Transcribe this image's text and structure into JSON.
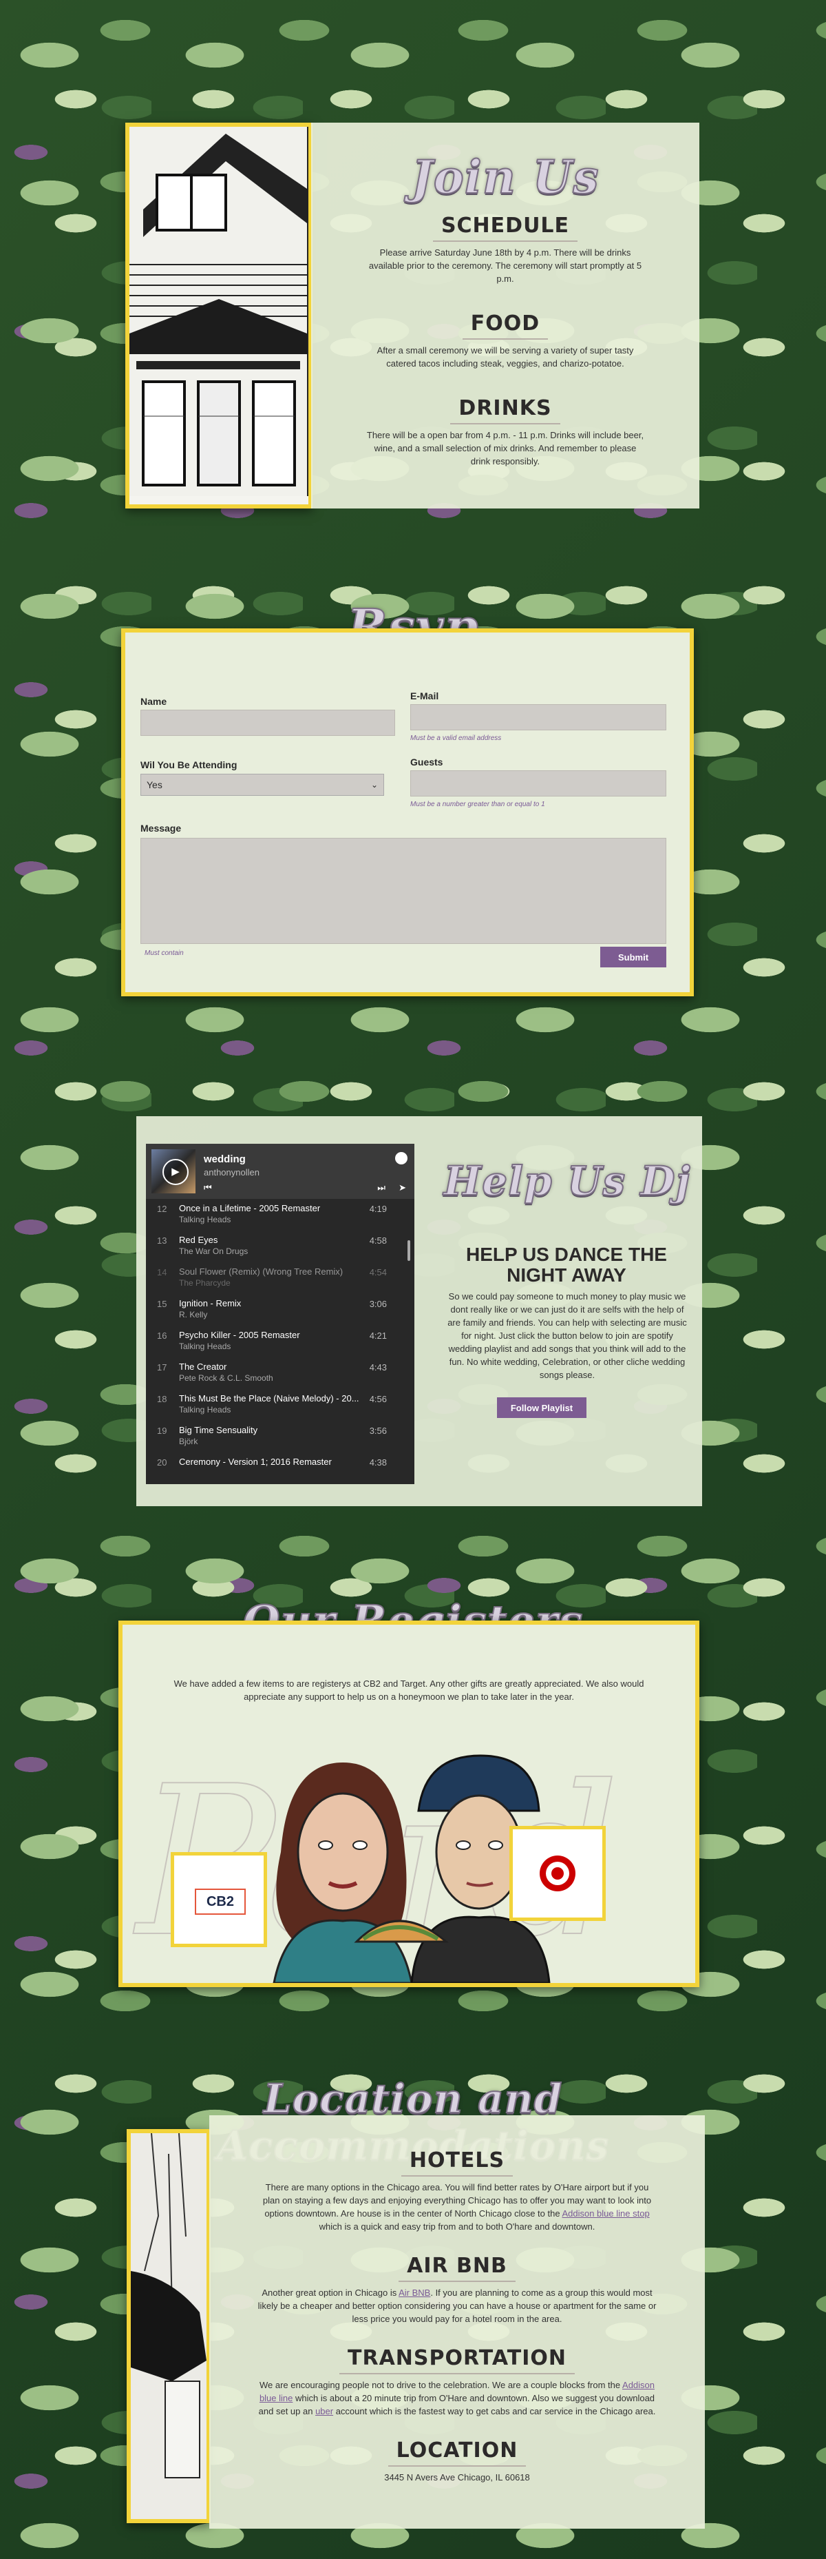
{
  "join": {
    "title": "Join Us",
    "schedule_h": "SCHEDULE",
    "schedule_p": "Please arrive Saturday June 18th by 4 p.m. There will be drinks available prior to the ceremony. The ceremony will start promptly at 5 p.m.",
    "food_h": "FOOD",
    "food_p": "After a small ceremony we will be serving a variety of super tasty catered tacos including steak, veggies, and charizo-potatoe.",
    "drinks_h": "DRINKS",
    "drinks_p": "There will be a open bar from 4 p.m. - 11 p.m. Drinks will include beer, wine, and a small selection of mix drinks. And remember to please drink responsibly."
  },
  "rsvp": {
    "title": "Rsvp",
    "name_label": "Name",
    "email_label": "E-Mail",
    "email_hint": "Must be a valid email address",
    "attending_label": "Wil You Be Attending",
    "attending_value": "Yes",
    "guests_label": "Guests",
    "guests_hint": "Must be a number greater than or equal to 1",
    "message_label": "Message",
    "message_hint": "Must contain",
    "submit": "Submit"
  },
  "dj": {
    "title": "Help Us Dj",
    "headline": "HELP US DANCE THE NIGHT AWAY",
    "body": "So we could pay someone to much money to play music we dont really like or we can just do it are selfs with the help of are family and friends. You can help with selecting are music for night. Just click the button below to join are spotify wedding playlist and add songs that you think will add to the fun. No white wedding, Celebration, or other cliche wedding songs please.",
    "button": "Follow Playlist",
    "playlist": {
      "name": "wedding",
      "owner": "anthonynollen",
      "tracks": [
        {
          "n": "12",
          "title": "Once in a Lifetime - 2005 Remaster",
          "artist": "Talking Heads",
          "dur": "4:19",
          "dim": false
        },
        {
          "n": "13",
          "title": "Red Eyes",
          "artist": "The War On Drugs",
          "dur": "4:58",
          "dim": false
        },
        {
          "n": "14",
          "title": "Soul Flower (Remix) (Wrong Tree Remix)",
          "artist": "The Pharcyde",
          "dur": "4:54",
          "dim": true
        },
        {
          "n": "15",
          "title": "Ignition - Remix",
          "artist": "R. Kelly",
          "dur": "3:06",
          "dim": false
        },
        {
          "n": "16",
          "title": "Psycho Killer - 2005 Remaster",
          "artist": "Talking Heads",
          "dur": "4:21",
          "dim": false
        },
        {
          "n": "17",
          "title": "The Creator",
          "artist": "Pete Rock & C.L. Smooth",
          "dur": "4:43",
          "dim": false
        },
        {
          "n": "18",
          "title": "This Must Be the Place (Naive Melody) - 20...",
          "artist": "Talking Heads",
          "dur": "4:56",
          "dim": false
        },
        {
          "n": "19",
          "title": "Big Time Sensuality",
          "artist": "Björk",
          "dur": "3:56",
          "dim": false
        },
        {
          "n": "20",
          "title": "Ceremony - Version 1; 2016 Remaster",
          "artist": "",
          "dur": "4:38",
          "dim": false
        }
      ]
    }
  },
  "registers": {
    "title": "Our Registers",
    "body": "We have added a few items to are registerys at CB2 and Target. Any other gifts are greatly appreciated. We also would appreciate any support to help us on a honeymoon we plan to take later in the year.",
    "cb2": "CB2"
  },
  "location": {
    "title": "Location and Accommodations",
    "hotels_h": "HOTELS",
    "hotels_p1": "There are many options in the Chicago area. You will find better rates by O'Hare airport but if you plan on staying a few days and enjoying everything Chicago has to offer you may want to look into options downtown. Are house is in the center of North Chicago close to the ",
    "hotels_link": "Addison blue line stop",
    "hotels_p2": " which is a quick and easy trip from and to both O'hare and downtown.",
    "airbnb_h": "AIR BNB",
    "airbnb_p1": "Another great option in Chicago is ",
    "airbnb_link": "Air BNB",
    "airbnb_p2": ". If you are planning to come as a group this would most likely be a cheaper and better option considering you can have a house or apartment for the same or less price you would pay for a hotel room in the area.",
    "trans_h": "TRANSPORTATION",
    "trans_p1": "We are encouraging people not to drive to the celebration. We are a couple blocks from the ",
    "trans_link1": "Addison blue line",
    "trans_p2": " which is about a 20 minute trip from O'Hare and downtown. Also we suggest you download and set up an ",
    "trans_link2": "uber",
    "trans_p3": " account which is the fastest way to get cabs and car service in the Chicago area.",
    "loc_h": "LOCATION",
    "address": "3445 N Avers Ave Chicago, IL 60618"
  },
  "colors": {
    "accent": "#7d5c92",
    "border": "#f2d33a",
    "panel": "#e8eedc"
  }
}
